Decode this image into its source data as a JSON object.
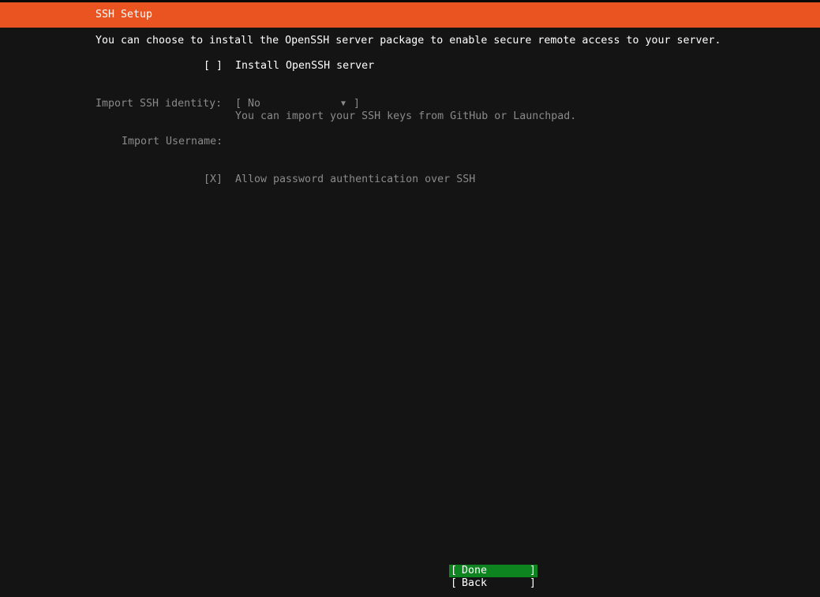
{
  "header": {
    "title": "SSH Setup"
  },
  "intro": "You can choose to install the OpenSSH server package to enable secure remote access to your server.",
  "install_openssh": {
    "checkbox": "[ ]",
    "label": "Install OpenSSH server",
    "checked": false
  },
  "import_identity": {
    "label": "Import SSH identity:",
    "open_bracket": "[",
    "value": "No",
    "arrow": "▼",
    "close_bracket": "]",
    "help": "You can import your SSH keys from GitHub or Launchpad."
  },
  "import_username": {
    "label": "Import Username:",
    "value": ""
  },
  "allow_password": {
    "checkbox": "[X]",
    "label": "Allow password authentication over SSH",
    "checked": true
  },
  "buttons": {
    "open_bracket": "[",
    "close_bracket": "]",
    "done_label": "Done",
    "back_label": "Back"
  },
  "colors": {
    "header_bg": "#e95420",
    "background": "#141414",
    "focus_bg": "#0e8420",
    "dim_text": "#8a8a8a"
  }
}
